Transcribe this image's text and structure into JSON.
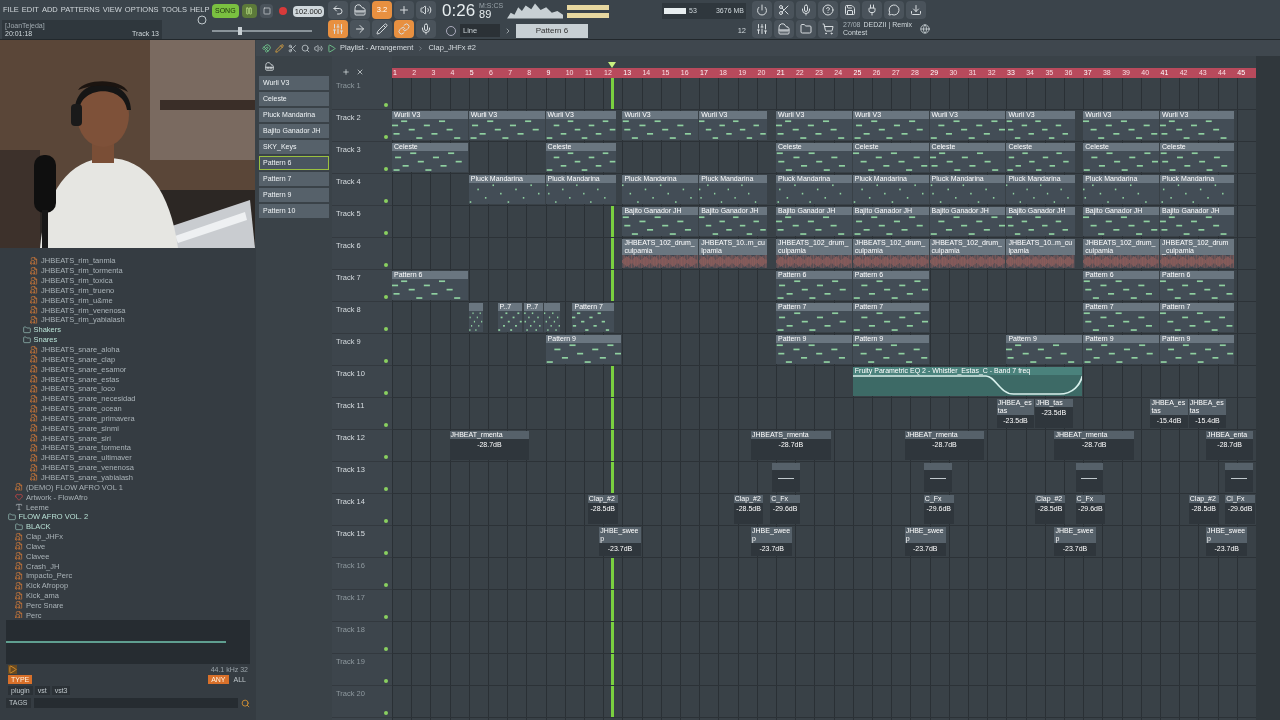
{
  "menu": [
    "FILE",
    "EDIT",
    "ADD",
    "PATTERNS",
    "VIEW",
    "OPTIONS",
    "TOOLS",
    "HELP"
  ],
  "hint": {
    "user": "[JoanTejeda]",
    "time": "20:01:18",
    "target": "Track 13"
  },
  "transport": {
    "mode": "SONG",
    "playing": true,
    "tempo": "102.000",
    "time": "0:26",
    "time_cs": "89",
    "time_unit": "M:S:CS",
    "snap_value": "3.2",
    "pitch": {
      "level": 0.27
    },
    "cpu": "53",
    "memory": "3676 MB",
    "polyphony": "12",
    "snap": "Line",
    "pattern": "Pattern 6",
    "news_date": "27/08",
    "news_title": "DEDZII | Remix",
    "news_subtitle": "Contest"
  },
  "browser": {
    "tree": [
      {
        "kind": "group",
        "children": [
          {
            "kind": "group",
            "children": [
              {
                "kind": "group",
                "children": [
                  {
                    "kind": "file",
                    "label": "JHBEATS_rim_tanmia"
                  },
                  {
                    "kind": "file",
                    "label": "JHBEATS_rim_tormenta"
                  },
                  {
                    "kind": "file",
                    "label": "JHBEATS_rim_toxica"
                  },
                  {
                    "kind": "file",
                    "label": "JHBEATS_rim_trueno"
                  },
                  {
                    "kind": "file",
                    "label": "JHBEATS_rim_u&me"
                  },
                  {
                    "kind": "file",
                    "label": "JHBEATS_rim_venenosa"
                  },
                  {
                    "kind": "file",
                    "label": "JHBEATS_rim_yabialash"
                  }
                ]
              },
              {
                "kind": "folder",
                "label": "Shakers"
              },
              {
                "kind": "folder",
                "label": "Snares",
                "children": [
                  {
                    "kind": "file",
                    "label": "JHBEATS_snare_aloha"
                  },
                  {
                    "kind": "file",
                    "label": "JHBEATS_snare_clap"
                  },
                  {
                    "kind": "file",
                    "label": "JHBEATS_snare_esamor"
                  },
                  {
                    "kind": "file",
                    "label": "JHBEATS_snare_estas"
                  },
                  {
                    "kind": "file",
                    "label": "JHBEATS_snare_loco"
                  },
                  {
                    "kind": "file",
                    "label": "JHBEATS_snare_necesidad"
                  },
                  {
                    "kind": "file",
                    "label": "JHBEATS_snare_ocean"
                  },
                  {
                    "kind": "file",
                    "label": "JHBEATS_snare_primavera"
                  },
                  {
                    "kind": "file",
                    "label": "JHBEATS_snare_sinmi"
                  },
                  {
                    "kind": "file",
                    "label": "JHBEATS_snare_siri"
                  },
                  {
                    "kind": "file",
                    "label": "JHBEATS_snare_tormenta"
                  },
                  {
                    "kind": "file",
                    "label": "JHBEATS_snare_ultimaver"
                  },
                  {
                    "kind": "file",
                    "label": "JHBEATS_snare_venenosa"
                  },
                  {
                    "kind": "file",
                    "label": "JHBEATS_snare_yabialash"
                  }
                ]
              }
            ]
          },
          {
            "kind": "file",
            "label": "(DEMO) FLOW AFRO VOL 1"
          },
          {
            "label": "Artwork - FlowAfro"
          },
          {
            "kind": "text",
            "label": "Leeme"
          }
        ]
      },
      {
        "kind": "folder",
        "label": "FLOW AFRO VOL. 2",
        "children": [
          {
            "kind": "folder",
            "label": "BLACK"
          },
          {
            "kind": "file",
            "label": "Clap_JHFx"
          },
          {
            "kind": "file",
            "label": "Clave"
          },
          {
            "kind": "file",
            "label": "Clavee"
          },
          {
            "kind": "file",
            "label": "Crash_JH"
          },
          {
            "kind": "file",
            "label": "Impacto_Perc"
          },
          {
            "kind": "file",
            "label": "Kick Afropop"
          },
          {
            "kind": "file",
            "label": "Kick_ama"
          },
          {
            "kind": "file",
            "label": "Perc Snare"
          },
          {
            "kind": "file",
            "label": "Perc"
          }
        ]
      }
    ],
    "preview_info": "44.1 kHz 32",
    "type_button": "TYPE",
    "any_button": "ANY",
    "all_button": "ALL",
    "tags": [
      "plugin",
      "vst",
      "vst3"
    ],
    "tags_label": "TAGS"
  },
  "playlist": {
    "title": "Playlist - Arrangement",
    "clip_name": "Clap_JHFx #2",
    "patterns": [
      {
        "label": "Wurli V3",
        "selected": false
      },
      {
        "label": "Celeste",
        "selected": false
      },
      {
        "label": "Pluck Mandarina",
        "selected": false
      },
      {
        "label": "Bajito Ganador JH",
        "selected": false
      },
      {
        "label": "SKY_Keys",
        "selected": false
      },
      {
        "label": "Pattern 6",
        "selected": true
      },
      {
        "label": "Pattern 7",
        "selected": false
      },
      {
        "label": "Pattern 9",
        "selected": false
      },
      {
        "label": "Pattern 10",
        "selected": false
      }
    ],
    "bars": [
      "1",
      "2",
      "3",
      "4",
      "5",
      "6",
      "7",
      "8",
      "9",
      "10",
      "11",
      "12",
      "13",
      "14",
      "15",
      "16",
      "17",
      "18",
      "19",
      "20",
      "21",
      "22",
      "23",
      "24",
      "25",
      "26",
      "27",
      "28",
      "29",
      "30",
      "31",
      "32",
      "33",
      "34",
      "35",
      "36",
      "37",
      "38",
      "39",
      "40",
      "41",
      "42",
      "43",
      "44",
      "45"
    ],
    "playhead": {
      "level": 0.253
    },
    "tracks": [
      {
        "name": "Track 1",
        "faded": true
      },
      {
        "name": "Track 2",
        "faded": false,
        "clips": [
          {
            "kind": "pattern",
            "label": "Wurli V3"
          },
          {
            "kind": "pattern",
            "label": "Wurli V3"
          },
          {
            "kind": "pattern",
            "label": "Wurli V3"
          },
          {
            "kind": "pattern",
            "label": "Wurli V3"
          },
          {
            "kind": "pattern",
            "label": "Wurli V3"
          },
          {
            "kind": "pattern",
            "label": "Wurli V3"
          },
          {
            "kind": "pattern",
            "label": "Wurli V3"
          },
          {
            "kind": "pattern",
            "label": "Wurli V3"
          },
          {
            "kind": "pattern",
            "label": "Wurli V3"
          },
          {
            "kind": "pattern",
            "label": "Wurli V3"
          },
          {
            "kind": "pattern",
            "label": "Wurli V3"
          }
        ]
      },
      {
        "name": "Track 3",
        "faded": false,
        "clips": [
          {
            "kind": "pattern",
            "label": "Celeste"
          },
          {
            "kind": "pattern",
            "label": "Celeste"
          },
          {
            "kind": "pattern",
            "label": "Celeste"
          },
          {
            "kind": "pattern",
            "label": "Celeste"
          },
          {
            "kind": "pattern",
            "label": "Celeste"
          },
          {
            "kind": "pattern",
            "label": "Celeste"
          },
          {
            "kind": "pattern",
            "label": "Celeste"
          },
          {
            "kind": "pattern",
            "label": "Celeste"
          }
        ]
      },
      {
        "name": "Track 4",
        "faded": false,
        "clips": [
          {
            "kind": "pattern",
            "label": "Pluck Mandarina"
          },
          {
            "kind": "pattern",
            "label": "Pluck Mandarina"
          },
          {
            "kind": "pattern",
            "label": "Pluck Mandarina"
          },
          {
            "kind": "pattern",
            "label": "Pluck Mandarina"
          },
          {
            "kind": "pattern",
            "label": "Pluck Mandarina"
          },
          {
            "kind": "pattern",
            "label": "Pluck Mandarina"
          },
          {
            "kind": "pattern",
            "label": "Pluck Mandarina"
          },
          {
            "kind": "pattern",
            "label": "Pluck Mandarina"
          },
          {
            "kind": "pattern",
            "label": "Pluck Mandarina"
          },
          {
            "kind": "pattern",
            "label": "Pluck Mandarina"
          }
        ]
      },
      {
        "name": "Track 5",
        "faded": false,
        "clips": [
          {
            "kind": "pattern",
            "label": "Bajito Ganador JH"
          },
          {
            "kind": "pattern",
            "label": "Bajito Ganador JH"
          },
          {
            "kind": "pattern",
            "label": "Bajito Ganador JH"
          },
          {
            "kind": "pattern",
            "label": "Bajito Ganador JH"
          },
          {
            "kind": "pattern",
            "label": "Bajito Ganador JH"
          },
          {
            "kind": "pattern",
            "label": "Bajito Ganador JH"
          },
          {
            "kind": "pattern",
            "label": "Bajito Ganador JH"
          },
          {
            "kind": "pattern",
            "label": "Bajito Ganador JH"
          }
        ]
      },
      {
        "name": "Track 6",
        "faded": false,
        "clips": [
          {
            "kind": "audio",
            "label": "JHBEATS_102_drum_culpamia"
          },
          {
            "kind": "audio",
            "label": "JHBEATS_10..m_culpamia"
          },
          {
            "kind": "audio",
            "label": "JHBEATS_102_drum_culpamia"
          },
          {
            "kind": "audio",
            "label": "JHBEATS_102_drum_culpamia"
          },
          {
            "kind": "audio",
            "label": "JHBEATS_102_drum_culpamia"
          },
          {
            "kind": "audio",
            "label": "JHBEATS_10..m_culpamia"
          },
          {
            "kind": "audio",
            "label": "JHBEATS_102_drum_culpamia"
          },
          {
            "kind": "audio",
            "label": "JHBEATS_102_drum_culpamia"
          }
        ]
      },
      {
        "name": "Track 7",
        "faded": false,
        "clips": [
          {
            "kind": "pattern",
            "label": "Pattern 6"
          },
          {
            "kind": "pattern",
            "label": "Pattern 6"
          },
          {
            "kind": "pattern",
            "label": "Pattern 6"
          },
          {
            "kind": "pattern",
            "label": "Pattern 6"
          },
          {
            "kind": "pattern",
            "label": "Pattern 6"
          }
        ]
      },
      {
        "name": "Track 8",
        "faded": false,
        "clips": [
          {
            "kind": "pattern"
          },
          {
            "kind": "pattern",
            "label": "P..7"
          },
          {
            "kind": "pattern",
            "label": "P..7"
          },
          {
            "kind": "pattern"
          },
          {
            "kind": "pattern",
            "label": "Pattern 7"
          },
          {
            "kind": "pattern",
            "label": "Pattern 7"
          },
          {
            "kind": "pattern",
            "label": "Pattern 7"
          },
          {
            "kind": "pattern",
            "label": "Pattern 7"
          },
          {
            "kind": "pattern",
            "label": "Pattern 7"
          }
        ]
      },
      {
        "name": "Track 9",
        "faded": false,
        "clips": [
          {
            "kind": "pattern",
            "label": "Pattern 9"
          },
          {
            "kind": "pattern",
            "label": "Pattern 9"
          },
          {
            "kind": "pattern",
            "label": "Pattern 9"
          },
          {
            "kind": "pattern",
            "label": "Pattern 9"
          },
          {
            "kind": "pattern",
            "label": "Pattern 9"
          },
          {
            "kind": "pattern",
            "label": "Pattern 9"
          }
        ]
      },
      {
        "name": "Track 10",
        "faded": false,
        "clips": [
          {
            "kind": "automation",
            "label": "Fruity Parametric EQ 2 - Whistler_Estas_C - Band 7 freq"
          }
        ]
      },
      {
        "name": "Track 11",
        "faded": false,
        "clips": [
          {
            "kind": "sample",
            "label": "JHBEA_estas",
            "value": "-23.5dB"
          },
          {
            "kind": "sample",
            "label": "JHB_tas",
            "value": "-23.5dB"
          },
          {
            "kind": "sample",
            "label": "JHBEA_estas",
            "value": "-15.4dB"
          },
          {
            "kind": "sample",
            "label": "JHBEA_estas",
            "value": "-15.4dB"
          }
        ]
      },
      {
        "name": "Track 12",
        "faded": false,
        "clips": [
          {
            "kind": "sample",
            "label": "JHBEAT_rmenta",
            "value": "-28.7dB"
          },
          {
            "kind": "sample",
            "label": "JHBEATS_rmenta",
            "value": "-28.7dB"
          },
          {
            "kind": "sample",
            "label": "JHBEAT_rmenta",
            "value": "-28.7dB"
          },
          {
            "kind": "sample",
            "label": "JHBEAT_rmenta",
            "value": "-28.7dB"
          },
          {
            "kind": "sample",
            "label": "JHBEA_enta",
            "value": "-28.7dB"
          }
        ]
      },
      {
        "name": "Track 13",
        "faded": false,
        "clips": [
          {
            "kind": "sample"
          },
          {
            "kind": "sample"
          },
          {
            "kind": "sample"
          },
          {
            "kind": "sample"
          }
        ]
      },
      {
        "name": "Track 14",
        "faded": false,
        "clips": [
          {
            "kind": "sample",
            "label": "Clap_#2",
            "value": "-28.5dB"
          },
          {
            "kind": "sample",
            "label": "Clap_#2",
            "value": "-28.5dB"
          },
          {
            "kind": "sample",
            "label": "C_Fx",
            "value": "-29.6dB"
          },
          {
            "kind": "sample",
            "label": "C_Fx",
            "value": "-29.6dB"
          },
          {
            "kind": "sample",
            "label": "Clap_#2",
            "value": "-28.5dB"
          },
          {
            "kind": "sample",
            "label": "C_Fx",
            "value": "-29.6dB"
          },
          {
            "kind": "sample",
            "label": "Clap_#2",
            "value": "-28.5dB"
          },
          {
            "kind": "sample",
            "label": "Cl_Fx",
            "value": "-29.6dB"
          }
        ]
      },
      {
        "name": "Track 15",
        "faded": false,
        "clips": [
          {
            "kind": "sample",
            "label": "JHBE_sweep",
            "value": "-23.7dB"
          },
          {
            "kind": "sample",
            "label": "JHBE_sweep",
            "value": "-23.7dB"
          },
          {
            "kind": "sample",
            "label": "JHBE_sweep",
            "value": "-23.7dB"
          },
          {
            "kind": "sample",
            "label": "JHBE_sweep",
            "value": "-23.7dB"
          },
          {
            "kind": "sample",
            "label": "JHBE_sweep",
            "value": "-23.7dB"
          }
        ]
      },
      {
        "name": "Track 16",
        "faded": true
      },
      {
        "name": "Track 17",
        "faded": true
      },
      {
        "name": "Track 18",
        "faded": true
      },
      {
        "name": "Track 19",
        "faded": true
      },
      {
        "name": "Track 20",
        "faded": true
      }
    ]
  }
}
